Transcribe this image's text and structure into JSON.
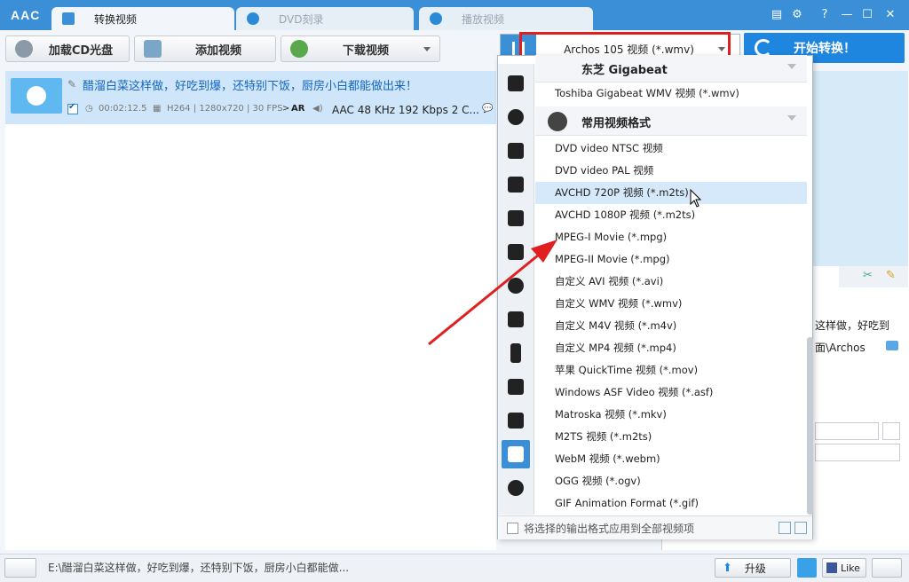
{
  "app": {
    "logo": "AAC"
  },
  "tabs": [
    {
      "label": "转换视频",
      "active": true
    },
    {
      "label": "DVD刻录",
      "active": false
    },
    {
      "label": "播放视频",
      "active": false
    }
  ],
  "window_controls": {
    "help": "?"
  },
  "toolbar": {
    "load_cd": "加载CD光盘",
    "add_video": "添加视频",
    "download_video": "下载视频",
    "format_selected": "Archos 105 视频 (*.wmv)",
    "start": "开始转换！"
  },
  "file": {
    "name": "醋溜白菜这样做，好吃到爆，还特别下饭，厨房小白都能做出来！",
    "duration": "00:02:12.5",
    "video_info": "H264 | 1280x720 | 30 FPS",
    "ar": "AR",
    "audio_info": "AAC 48 KHz 192 Kbps 2 C..."
  },
  "right_panel": {
    "title_snippet": "这样做，好吃到",
    "path_snippet": "面\\Archos"
  },
  "dropdown": {
    "partial_group": "东芝 Gigabeat",
    "partial_item": "Toshiba Gigabeat WMV 视频 (*.wmv)",
    "group": "常用视频格式",
    "items": [
      "DVD video NTSC 视频",
      "DVD video PAL 视频",
      "AVCHD 720P 视频 (*.m2ts)",
      "AVCHD 1080P 视频 (*.m2ts)",
      "MPEG-I Movie (*.mpg)",
      "MPEG-II Movie (*.mpg)",
      "自定义 AVI 视频 (*.avi)",
      "自定义 WMV 视频 (*.wmv)",
      "自定义 M4V 视频 (*.m4v)",
      "自定义 MP4 视频 (*.mp4)",
      "苹果 QuickTime 视频 (*.mov)",
      "Windows ASF Video 视频 (*.asf)",
      "Matroska 视频 (*.mkv)",
      "M2TS 视频 (*.m2ts)",
      "WebM 视频 (*.webm)",
      "OGG 视频 (*.ogv)",
      "GIF Animation Format (*.gif)"
    ],
    "hovered_item": "AVCHD 720P 视频 (*.m2ts)",
    "apply_all": "将选择的输出格式应用到全部视频项"
  },
  "status": {
    "path": "E:\\醋溜白菜这样做，好吃到爆，还特别下饭，厨房小白都能做...",
    "upgrade": "升级",
    "like": "Like"
  },
  "colors": {
    "accent": "#3a8fd6",
    "highlight": "#e02020"
  }
}
